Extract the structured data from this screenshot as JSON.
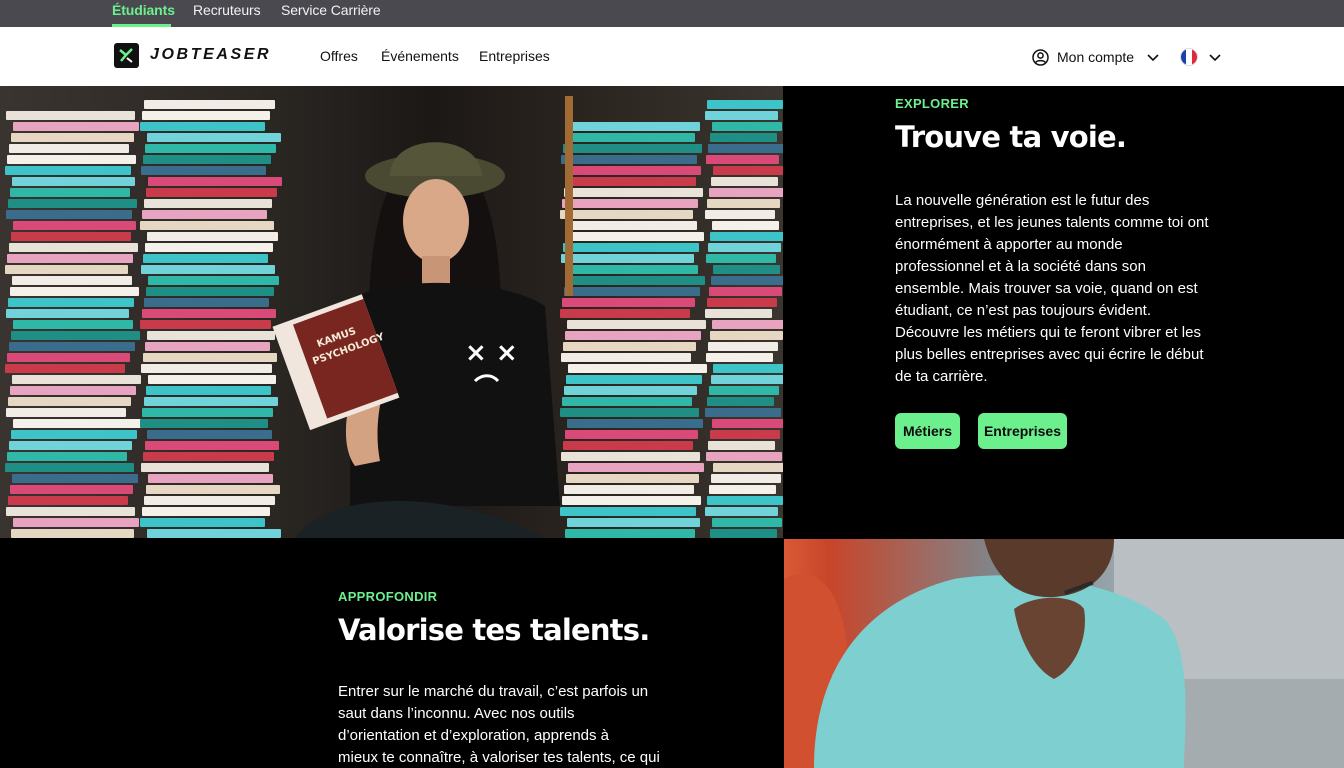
{
  "audience_nav": {
    "items": [
      {
        "label": "Étudiants",
        "active": true
      },
      {
        "label": "Recruteurs",
        "active": false
      },
      {
        "label": "Service Carrière",
        "active": false
      }
    ]
  },
  "header": {
    "logo_text": "JOBTEASER",
    "nav": [
      "Offres",
      "Événements",
      "Entreprises"
    ],
    "account_label": "Mon compte",
    "language_icon": "french-flag-icon"
  },
  "sections": [
    {
      "eyebrow": "EXPLORER",
      "title": "Trouve ta voie.",
      "lines": [
        "La nouvelle génération est le futur des",
        "entreprises, et les jeunes talents comme toi ont",
        "énormément à apporter au monde",
        "professionnel et à la société dans son",
        "ensemble. Mais trouver sa voie, quand on est",
        "étudiant, ce n’est pas toujours évident.",
        "Découvre les métiers qui te feront vibrer et les",
        "plus belles entreprises avec qui écrire le début",
        "de ta carrière."
      ],
      "buttons": [
        "Métiers",
        "Entreprises"
      ]
    },
    {
      "eyebrow": "APPROFONDIR",
      "title": "Valorise tes talents.",
      "lines": [
        "Entrer sur le marché du travail, c’est parfois un",
        "saut dans l’inconnu. Avec nos outils",
        "d’orientation et d’exploration, apprends à",
        "mieux te connaître, à valoriser tes talents, ce qui"
      ]
    }
  ],
  "book_cover": {
    "line1": "KAMUS",
    "line2": "PSYCHOLOGY"
  },
  "colors": {
    "accent": "#6cf08e",
    "topbar_bg": "#4a4950",
    "nav_bg": "#ffffff",
    "page_bg": "#000000"
  }
}
